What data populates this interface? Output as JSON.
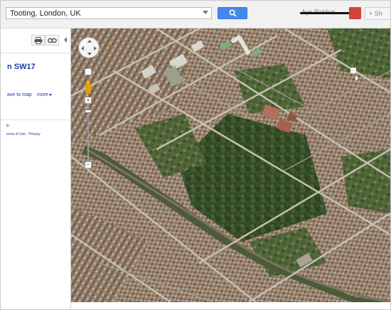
{
  "search": {
    "value": "Tooting, London, UK"
  },
  "header": {
    "user_name": "Ayo Rabbat",
    "share_label": "+ Sh"
  },
  "sidebar": {
    "place_title": "n SW17",
    "save_to_map": "ave to map",
    "more": "more",
    "help": "lp",
    "terms": "erms of Use - Privacy"
  },
  "map": {
    "type": "satellite",
    "zoom_in_label": "+",
    "zoom_out_label": "−"
  },
  "icons": {
    "search": "search-icon",
    "print": "print-icon",
    "link": "link-icon",
    "pan": "pan-control",
    "pegman": "street-view-pegman"
  },
  "colors": {
    "search_button": "#4787ed",
    "avatar": "#d0443a",
    "link_text": "#1a3aa8",
    "pegman": "#f2a900"
  }
}
